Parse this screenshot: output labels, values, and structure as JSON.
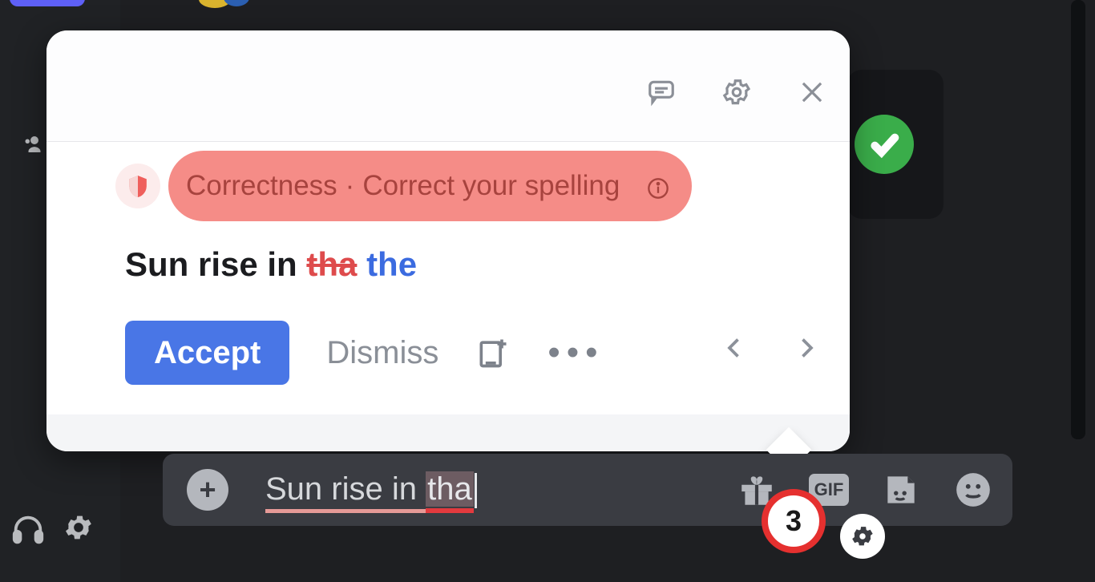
{
  "popup": {
    "category": "Correctness",
    "hint": "Correct your spelling",
    "sentence_prefix": "Sun rise in ",
    "wrong_word": "tha",
    "suggestion": "the",
    "accept_label": "Accept",
    "dismiss_label": "Dismiss"
  },
  "input": {
    "text_before_error": "Sun rise in ",
    "error_word": "tha"
  },
  "grammarly": {
    "count": "3"
  },
  "icons": {
    "gif_label": "GIF"
  }
}
